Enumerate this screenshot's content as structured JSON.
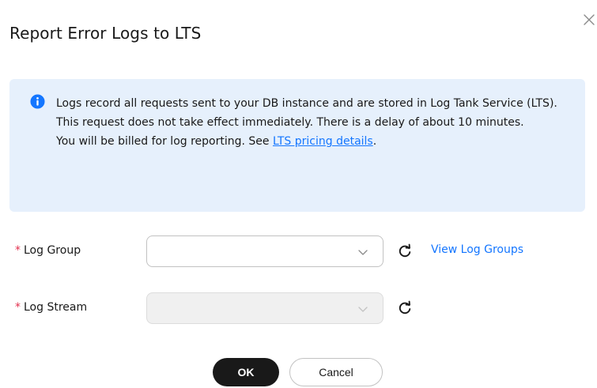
{
  "dialog": {
    "title": "Report Error Logs to LTS",
    "close_icon": "close-icon"
  },
  "info": {
    "icon": "info-icon",
    "line1": "Logs record all requests sent to your DB instance and are stored in Log Tank Service (LTS).",
    "line2": "This request does not take effect immediately. There is a delay of about 10 minutes.",
    "line3_prefix": "You will be billed for log reporting. See ",
    "link_text": "LTS pricing details",
    "line3_suffix": "."
  },
  "form": {
    "log_group": {
      "required_mark": "*",
      "label": "Log Group",
      "value": "",
      "disabled": false,
      "refresh_icon": "refresh-icon",
      "view_link": "View Log Groups"
    },
    "log_stream": {
      "required_mark": "*",
      "label": "Log Stream",
      "value": "",
      "disabled": true,
      "refresh_icon": "refresh-icon"
    }
  },
  "actions": {
    "ok_label": "OK",
    "cancel_label": "Cancel"
  },
  "colors": {
    "accent": "#1476ff",
    "info_bg": "#e6f0fc",
    "required": "#e2304e",
    "primary_button": "#191919"
  }
}
